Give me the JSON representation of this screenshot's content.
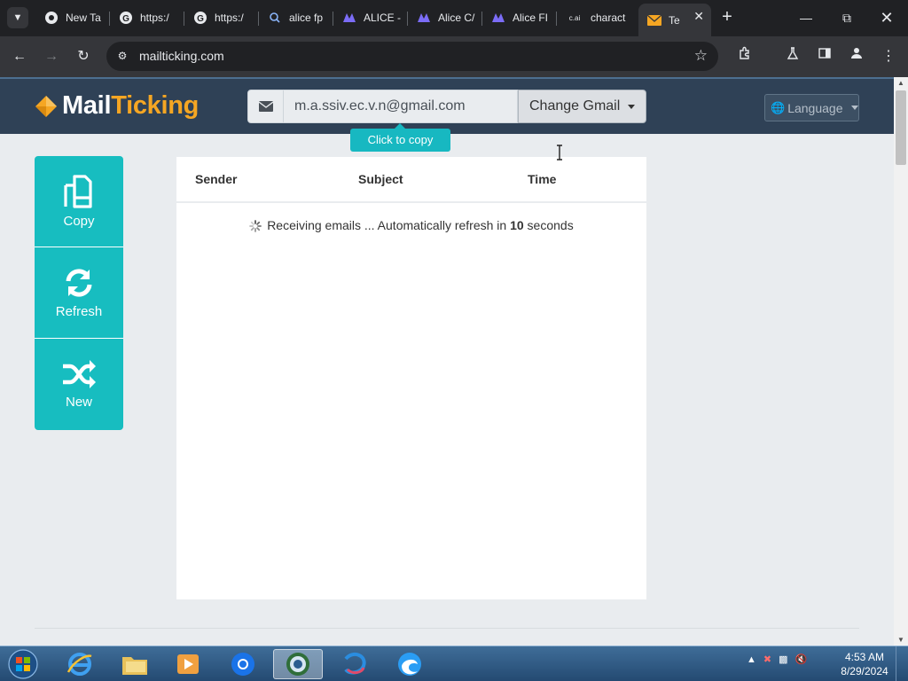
{
  "browser": {
    "tabs": [
      {
        "title": "New Ta",
        "icon": "chrome-icon"
      },
      {
        "title": "https:/",
        "icon": "google-icon"
      },
      {
        "title": "https:/",
        "icon": "google-icon"
      },
      {
        "title": "alice fp",
        "icon": "search-icon"
      },
      {
        "title": "ALICE -",
        "icon": "alice-icon"
      },
      {
        "title": "Alice C/",
        "icon": "alice-icon"
      },
      {
        "title": "Alice FI",
        "icon": "alice-icon"
      },
      {
        "title": "charact",
        "icon": "character-ai-icon",
        "badge": "c.ai"
      },
      {
        "title": "Te",
        "icon": "mail-icon",
        "active": true
      }
    ],
    "url": "mailticking.com",
    "accent": "#17bdc0"
  },
  "site": {
    "brand_white": "Mail",
    "brand_orange": "Ticking",
    "email_value": "m.a.ssiv.ec.v.n@gmail.com",
    "change_label": "Change Gmail",
    "copy_tip": "Click to copy",
    "language_label": "Language"
  },
  "sidebar": [
    {
      "label": "Copy",
      "icon": "copy-icon"
    },
    {
      "label": "Refresh",
      "icon": "refresh-icon"
    },
    {
      "label": "New",
      "icon": "shuffle-icon"
    }
  ],
  "inbox": {
    "columns": [
      "Sender",
      "Subject",
      "Time"
    ],
    "status_prefix": "Receiving emails ... Automatically refresh in",
    "countdown": "10",
    "status_suffix": "seconds"
  },
  "taskbar": {
    "time": "4:53 AM",
    "date": "8/29/2024",
    "apps": [
      "internet-explorer-icon",
      "file-explorer-icon",
      "media-player-icon",
      "chrome-icon",
      "active-app-icon",
      "app-icon",
      "edge-icon"
    ]
  }
}
